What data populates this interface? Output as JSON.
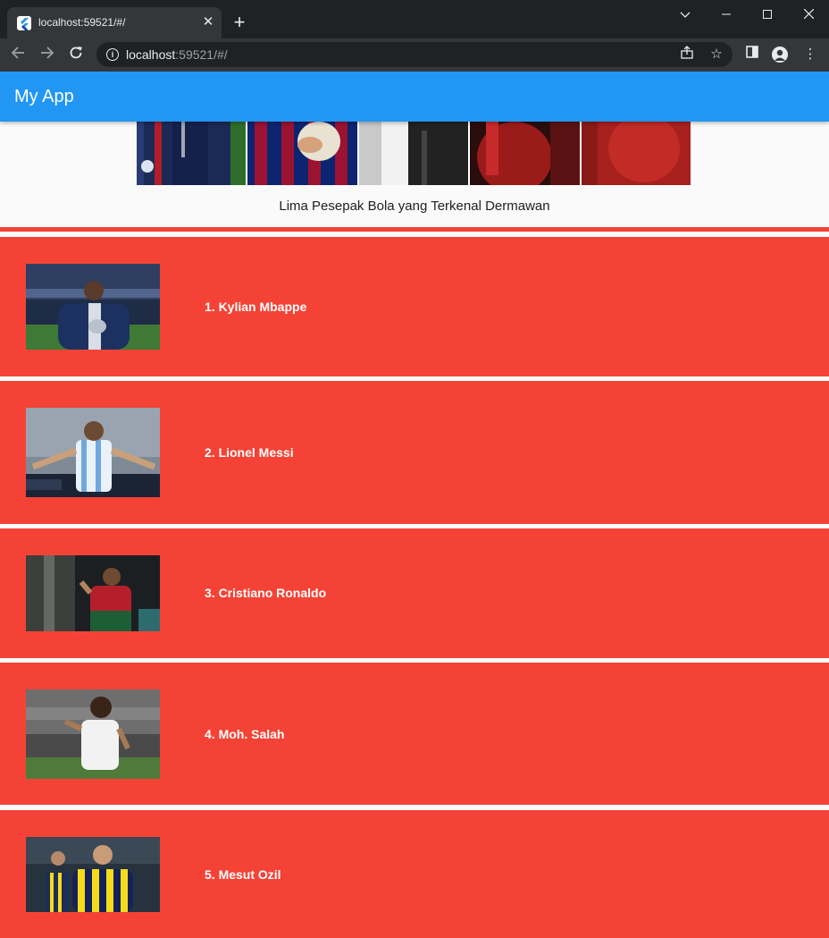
{
  "browser": {
    "tab_title": "localhost:59521/#/",
    "url_host": "localhost",
    "url_rest": ":59521/#/",
    "icons": [
      "flutter-favicon",
      "close-icon",
      "plus-icon",
      "chevron-down-icon",
      "minimize-icon",
      "maximize-icon",
      "close-window-icon",
      "back-icon",
      "forward-icon",
      "reload-icon",
      "info-icon",
      "share-icon",
      "star-icon",
      "side-panel-icon",
      "profile-icon",
      "more-vert-icon"
    ]
  },
  "app": {
    "title": "My App",
    "caption": "Lima Pesepak Bola yang Terkenal Dermawan",
    "colors": {
      "appbar": "#2196f3",
      "item": "#f44336"
    },
    "players": [
      {
        "name": "1. Kylian Mbappe"
      },
      {
        "name": "2. Lionel Messi"
      },
      {
        "name": "3. Cristiano Ronaldo"
      },
      {
        "name": "4. Moh. Salah"
      },
      {
        "name": "5. Mesut Ozil"
      }
    ]
  }
}
